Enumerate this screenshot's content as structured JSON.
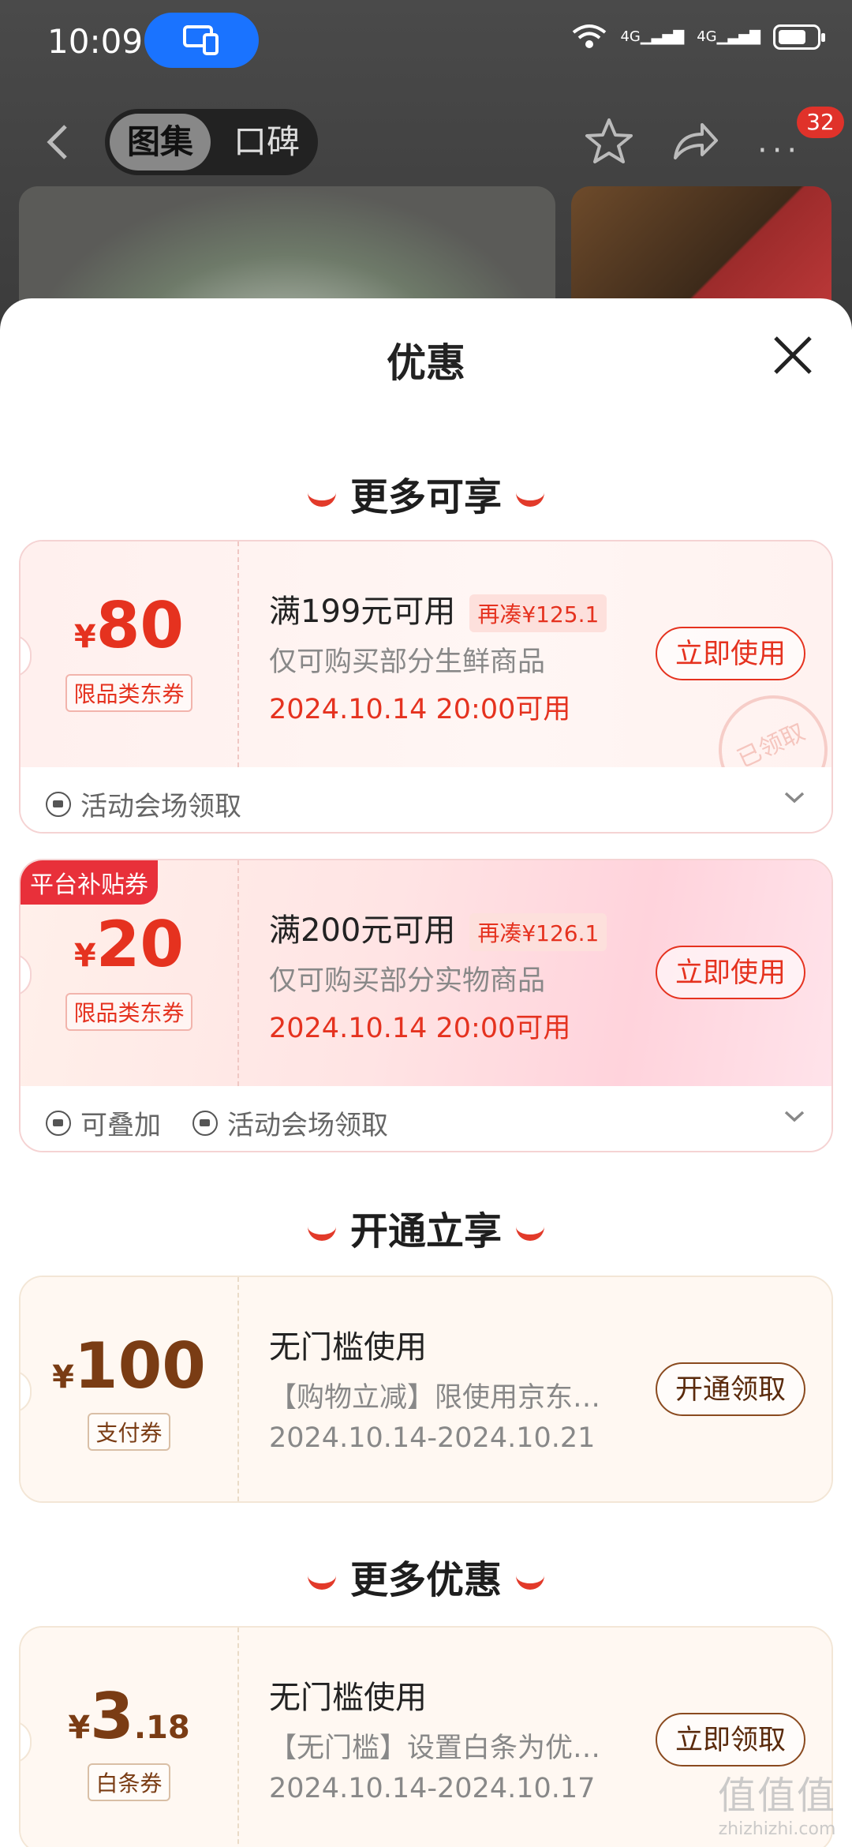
{
  "status_bar": {
    "time": "10:09",
    "signal_1": "4G",
    "signal_2": "4G"
  },
  "nav": {
    "tabs": [
      "图集",
      "口碑"
    ],
    "badge_count": "32"
  },
  "sheet": {
    "title": "优惠"
  },
  "sections": [
    {
      "title": "更多可享"
    },
    {
      "title": "开通立享"
    },
    {
      "title": "更多优惠"
    }
  ],
  "coupons": [
    {
      "currency": "¥",
      "amount": "80",
      "decimal": "",
      "type": "限品类东券",
      "condition": "满199元可用",
      "gap": "再凑¥125.1",
      "desc": "仅可购买部分生鲜商品",
      "time": "2024.10.14 20:00可用",
      "button": "立即使用",
      "stamp": "已领取",
      "foot": [
        "活动会场领取"
      ]
    },
    {
      "platform_tag": "平台补贴券",
      "currency": "¥",
      "amount": "20",
      "decimal": "",
      "type": "限品类东券",
      "condition": "满200元可用",
      "gap": "再凑¥126.1",
      "desc": "仅可购买部分实物商品",
      "time": "2024.10.14 20:00可用",
      "button": "立即使用",
      "foot": [
        "可叠加",
        "活动会场领取"
      ]
    },
    {
      "currency": "¥",
      "amount": "100",
      "decimal": "",
      "type": "支付券",
      "condition": "无门槛使用",
      "desc": "【购物立减】限使用京东…",
      "time": "2024.10.14-2024.10.21",
      "button": "开通领取"
    },
    {
      "currency": "¥",
      "amount": "3",
      "decimal": ".18",
      "type": "白条券",
      "condition": "无门槛使用",
      "desc": "【无门槛】设置白条为优…",
      "time": "2024.10.14-2024.10.17",
      "button": "立即领取"
    }
  ],
  "watermark": {
    "line1": "值值值",
    "line2": "zhizhizhi.com"
  },
  "colors": {
    "accent_red": "#e5321f",
    "gold_text": "#7a3c14",
    "platform_tag": "#e8303a"
  }
}
